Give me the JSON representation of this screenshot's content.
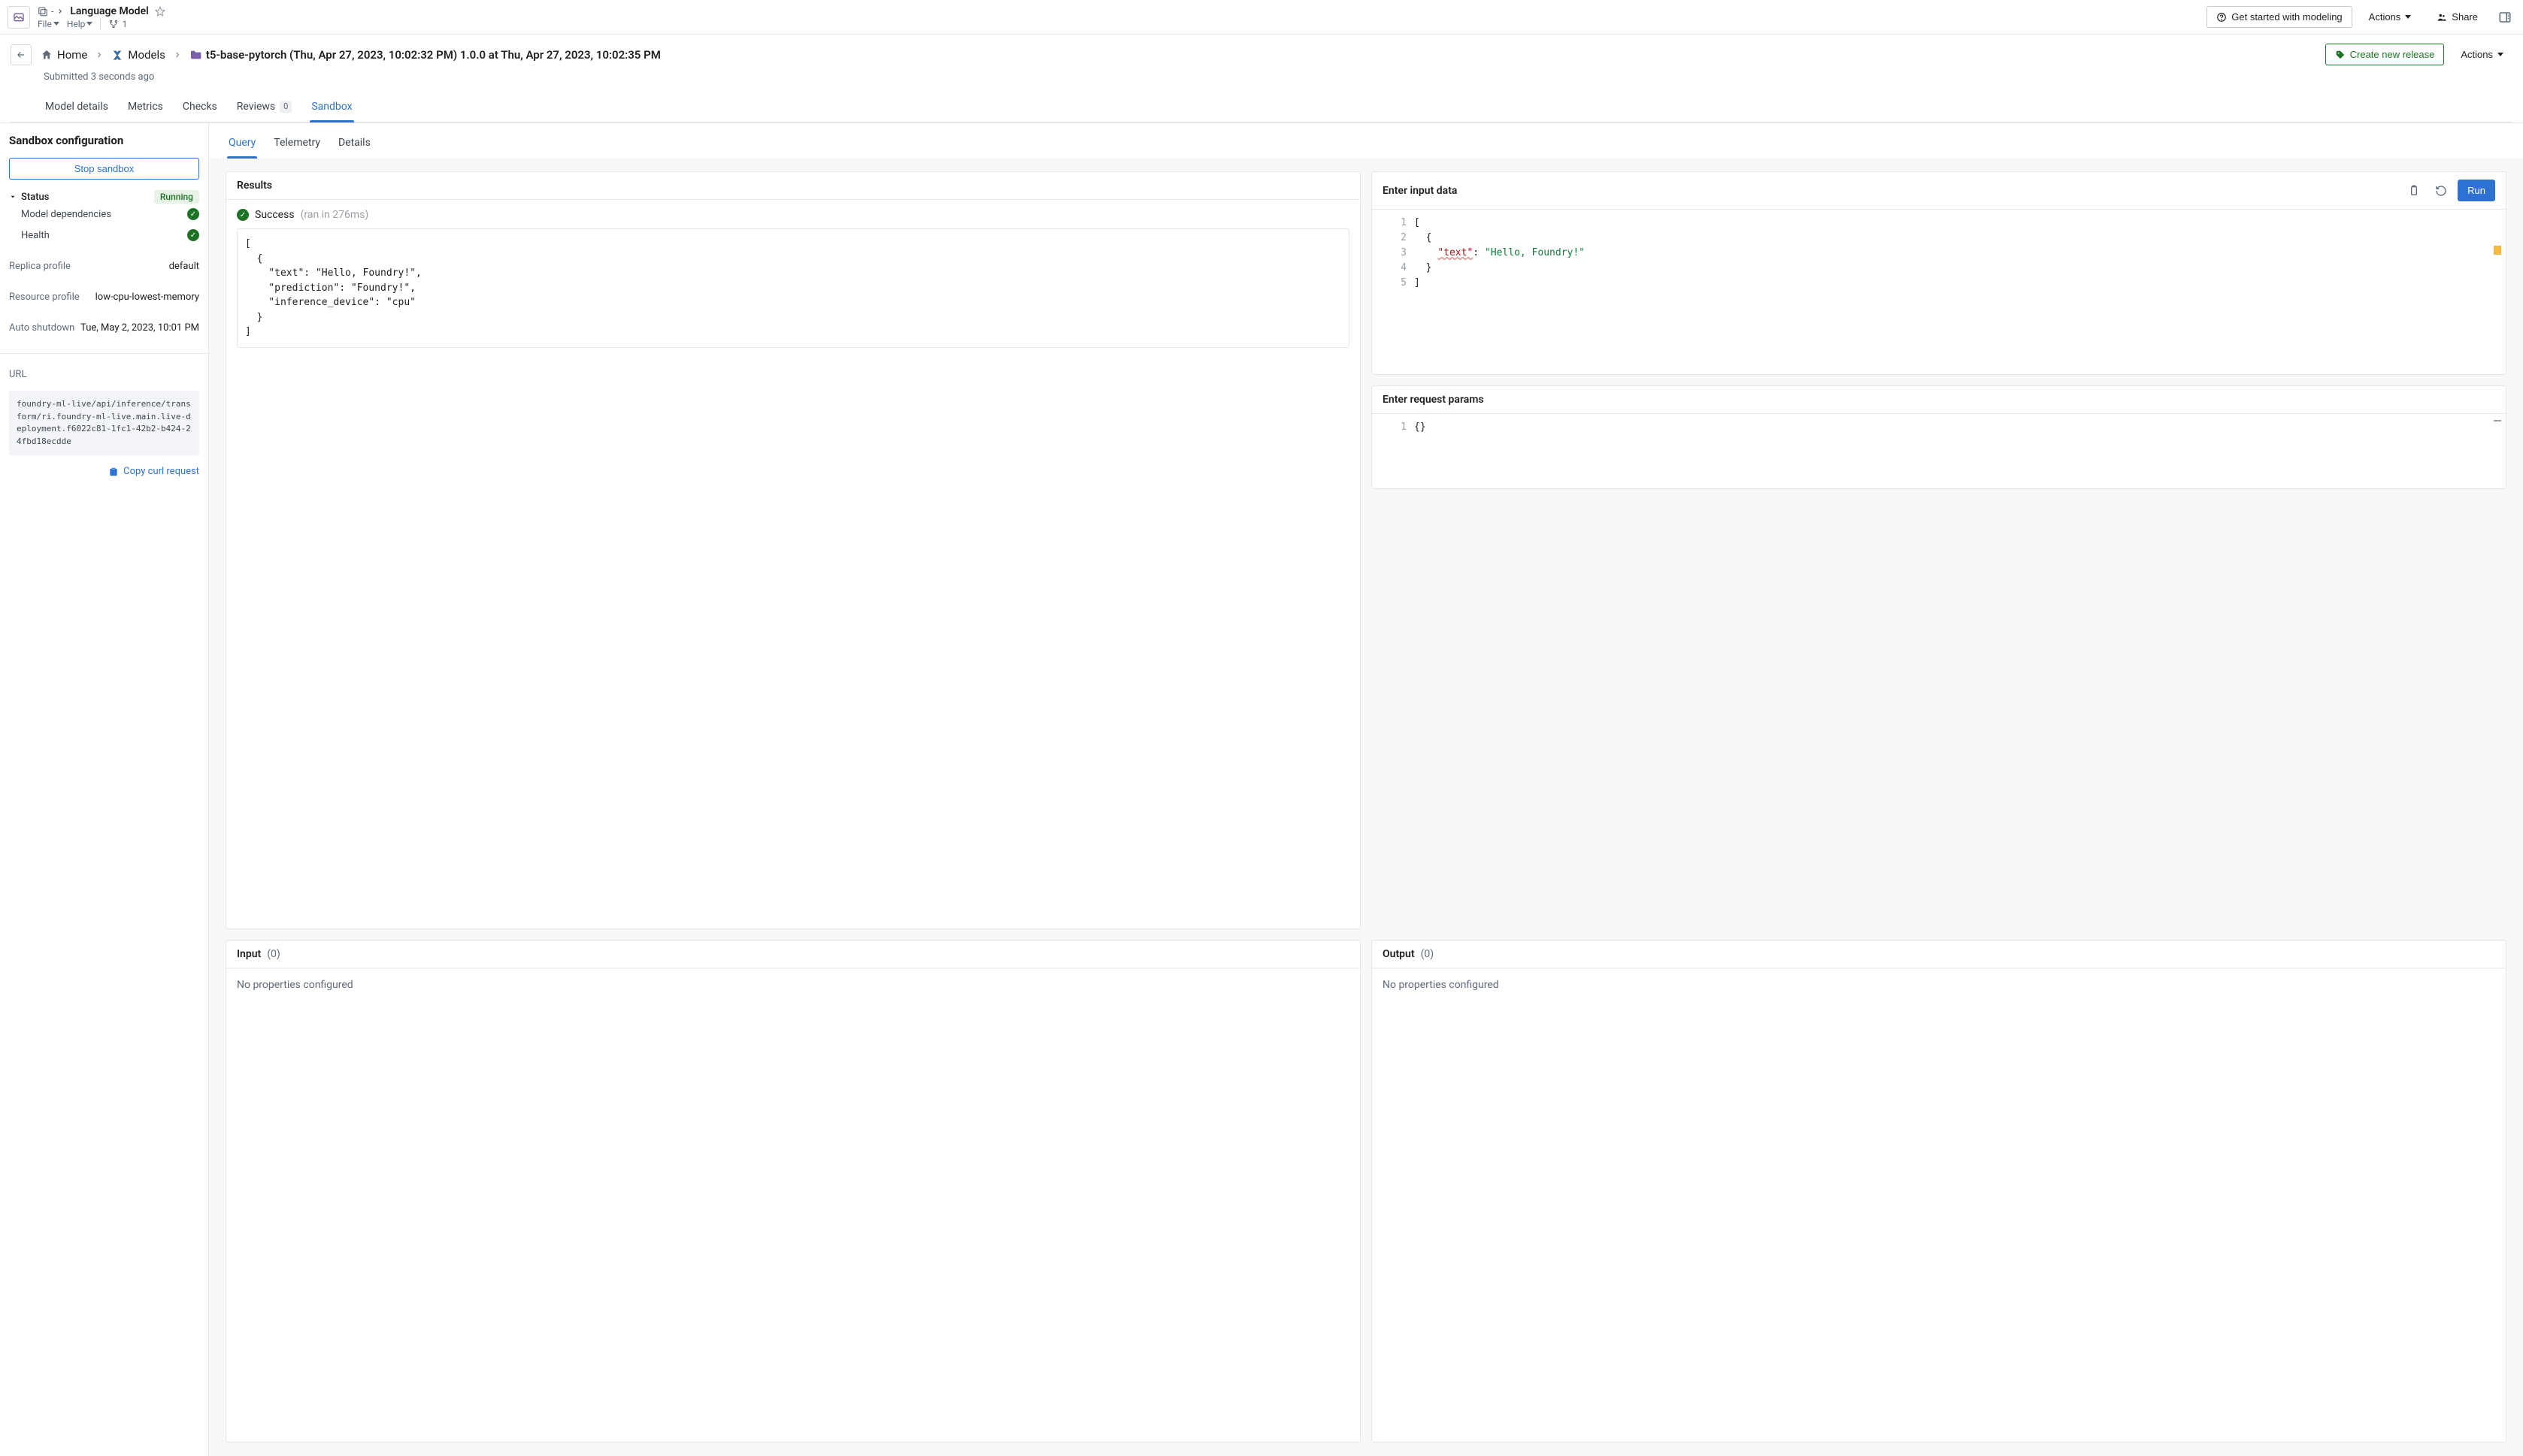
{
  "topbar": {
    "crumb_prefix": "-",
    "page_title": "Language Model",
    "menus": {
      "file": "File",
      "help": "Help"
    },
    "branch_count": "1",
    "get_started": "Get started with modeling",
    "actions": "Actions",
    "share": "Share"
  },
  "breadcrumb": {
    "home": "Home",
    "models": "Models",
    "current": "t5-base-pytorch (Thu, Apr 27, 2023, 10:02:32 PM) 1.0.0 at Thu, Apr 27, 2023, 10:02:35 PM",
    "create_release": "Create new release",
    "actions": "Actions"
  },
  "submitted": "Submitted 3 seconds ago",
  "tabs_main": {
    "model_details": "Model details",
    "metrics": "Metrics",
    "checks": "Checks",
    "reviews": "Reviews",
    "reviews_count": "0",
    "sandbox": "Sandbox"
  },
  "sidebar": {
    "title": "Sandbox configuration",
    "stop": "Stop sandbox",
    "status_label": "Status",
    "status_value": "Running",
    "model_deps": "Model dependencies",
    "health": "Health",
    "replica_label": "Replica profile",
    "replica_value": "default",
    "resource_label": "Resource profile",
    "resource_value": "low-cpu-lowest-memory",
    "auto_label": "Auto shutdown",
    "auto_value": "Tue, May 2, 2023, 10:01 PM",
    "url_label": "URL",
    "url_value": "foundry-ml-live/api/inference/transform/ri.foundry-ml-live.main.live-deployment.f6022c81-1fc1-42b2-b424-24fbd18ecdde",
    "copy": "Copy curl request"
  },
  "tabs_sub": {
    "query": "Query",
    "telemetry": "Telemetry",
    "details": "Details"
  },
  "input_panel": {
    "title": "Enter input data",
    "run": "Run",
    "lines": [
      "[",
      "  {",
      "    \"text\": \"Hello, Foundry!\"",
      "  }",
      "]"
    ],
    "line_numbers": [
      "1",
      "2",
      "3",
      "4",
      "5"
    ]
  },
  "params_panel": {
    "title": "Enter request params",
    "lines": [
      "{}"
    ],
    "line_numbers": [
      "1"
    ]
  },
  "results_panel": {
    "title": "Results",
    "status": "Success",
    "timing": "(ran in 276ms)",
    "json": "[\n  {\n    \"text\": \"Hello, Foundry!\",\n    \"prediction\": \"Foundry!\",\n    \"inference_device\": \"cpu\"\n  }\n]"
  },
  "input_schema": {
    "title": "Input",
    "count": "(0)",
    "empty": "No properties configured"
  },
  "output_schema": {
    "title": "Output",
    "count": "(0)",
    "empty": "No properties configured"
  }
}
